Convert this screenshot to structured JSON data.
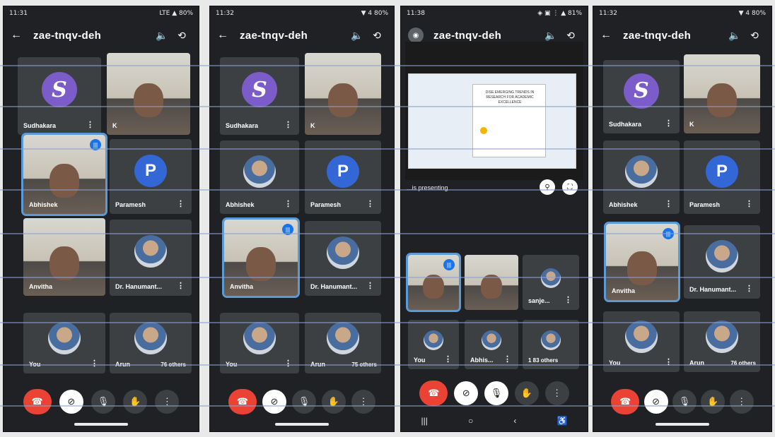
{
  "screens": [
    {
      "status_time": "11:31",
      "status_right": "LTE ▲ 80%",
      "meeting_code": "zae-tnqv-deh",
      "tiles": [
        {
          "label": "Sudhakara",
          "kind": "avatar-s",
          "letter": "S"
        },
        {
          "label": "K",
          "kind": "video"
        },
        {
          "label": "Abhishek",
          "kind": "video",
          "speaking": true
        },
        {
          "label": "Paramesh",
          "kind": "avatar-p",
          "letter": "P"
        },
        {
          "label": "Anvitha",
          "kind": "video"
        },
        {
          "label": "Dr. Hanumant...",
          "kind": "photo"
        },
        {
          "label": "You",
          "kind": "photo"
        },
        {
          "label": "Arun",
          "kind": "photo",
          "extra": "76 others"
        }
      ]
    },
    {
      "status_time": "11:32",
      "status_right": "▼ 4 80%",
      "meeting_code": "zae-tnqv-deh",
      "tiles": [
        {
          "label": "Sudhakara",
          "kind": "avatar-s",
          "letter": "S"
        },
        {
          "label": "K",
          "kind": "video"
        },
        {
          "label": "Abhishek",
          "kind": "photo"
        },
        {
          "label": "Paramesh",
          "kind": "avatar-p",
          "letter": "P"
        },
        {
          "label": "Anvitha",
          "kind": "video",
          "speaking": true
        },
        {
          "label": "Dr. Hanumant...",
          "kind": "photo"
        },
        {
          "label": "You",
          "kind": "photo"
        },
        {
          "label": "Arun",
          "kind": "photo",
          "extra": "75 others"
        }
      ]
    },
    {
      "status_time": "11:38",
      "status_right": "◈ ▣ ⋮ ▲ 81%",
      "meeting_code": "zae-tnqv-deh",
      "presenting_label": "...is presenting",
      "slide_title": "DISE EMERGING TRENDS IN RESEARCH FOR ACADEMIC EXCELLENCE",
      "tiles": [
        {
          "label": "",
          "kind": "video",
          "speaking": true
        },
        {
          "label": "",
          "kind": "video"
        },
        {
          "label": "sanje...",
          "kind": "photo-sm"
        },
        {
          "label": "You",
          "kind": "photo-sm"
        },
        {
          "label": "Abhis...",
          "kind": "photo-sm"
        },
        {
          "label": "",
          "kind": "photo-sm",
          "extra": "1 83 others"
        }
      ]
    },
    {
      "status_time": "11:32",
      "status_right": "▼ 4 80%",
      "meeting_code": "zae-tnqv-deh",
      "tiles": [
        {
          "label": "Sudhakara",
          "kind": "avatar-s",
          "letter": "S"
        },
        {
          "label": "K",
          "kind": "video"
        },
        {
          "label": "Abhishek",
          "kind": "photo"
        },
        {
          "label": "Paramesh",
          "kind": "avatar-p",
          "letter": "P"
        },
        {
          "label": "Anvitha",
          "kind": "video",
          "speaking": true
        },
        {
          "label": "Dr. Hanumant...",
          "kind": "photo"
        },
        {
          "label": "You",
          "kind": "photo"
        },
        {
          "label": "Arun",
          "kind": "photo",
          "extra": "76 others"
        }
      ]
    }
  ],
  "icons": {
    "back": "←",
    "speaker": "🔈",
    "switch_camera": "⟲",
    "end_call": "☎",
    "camera_off": "⊘",
    "mic": "🎙",
    "raise_hand": "✋",
    "more": "⋮",
    "nav_recent": "|||",
    "nav_home": "○",
    "nav_back": "‹",
    "nav_access": "♿"
  },
  "colors": {
    "end_call": "#ea4335",
    "speaking_outline": "#5b9bd5",
    "avatar_s": "#7b5cc8",
    "avatar_p": "#3367d6"
  }
}
